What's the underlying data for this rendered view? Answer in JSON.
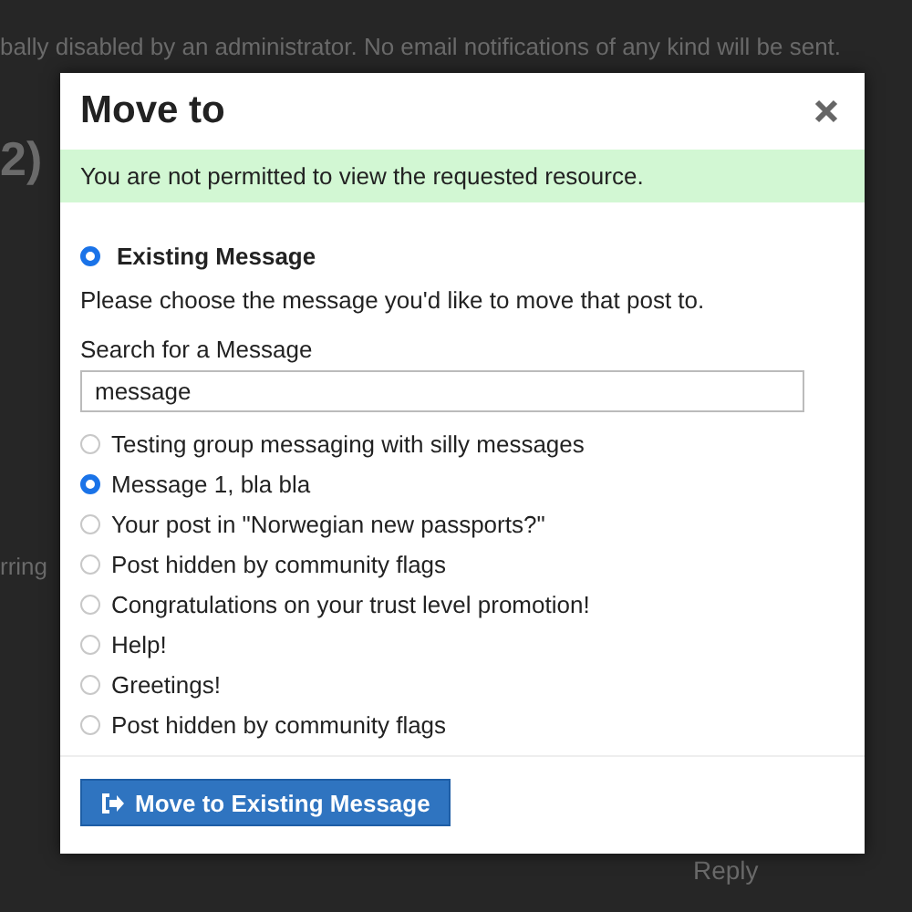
{
  "background": {
    "notice": "bally disabled by an administrator. No email notifications of any kind will be sent.",
    "heading": "2)",
    "fragment": "rring",
    "reply": "Reply"
  },
  "dialog": {
    "title": "Move to",
    "alert": "You are not permitted to view the requested resource.",
    "mode": {
      "label": "Existing Message",
      "selected": true
    },
    "instructions": "Please choose the message you'd like to move that post to.",
    "search": {
      "label": "Search for a Message",
      "value": "message"
    },
    "results": [
      {
        "title": "Testing group messaging with silly messages",
        "selected": false
      },
      {
        "title": "Message 1, bla bla",
        "selected": true
      },
      {
        "title": "Your post in \"Norwegian new passports?\"",
        "selected": false
      },
      {
        "title": "Post hidden by community flags",
        "selected": false
      },
      {
        "title": "Congratulations on your trust level promotion!",
        "selected": false
      },
      {
        "title": "Help!",
        "selected": false
      },
      {
        "title": "Greetings!",
        "selected": false
      },
      {
        "title": "Post hidden by community flags",
        "selected": false
      }
    ],
    "button": "Move to Existing Message"
  }
}
